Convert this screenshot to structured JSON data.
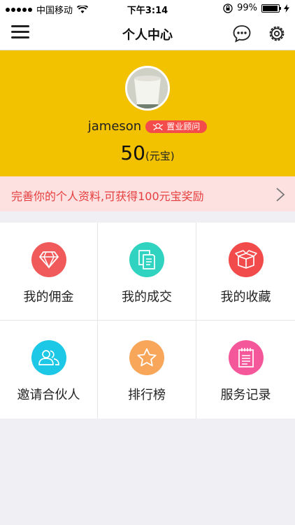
{
  "status_bar": {
    "carrier": "中国移动",
    "time": "下午3:14",
    "battery": "99%",
    "battery_level": 0.99
  },
  "nav": {
    "title": "个人中心",
    "icons": [
      "menu-icon",
      "chat-icon",
      "gear-icon"
    ]
  },
  "profile": {
    "username": "jameson",
    "role_badge": "置业顾问",
    "balance": "50",
    "balance_unit": "(元宝)",
    "background_color": "#f2c200"
  },
  "promo": {
    "text": "完善你的个人资料,可获得100元宝奖励"
  },
  "grid": {
    "items": [
      {
        "label": "我的佣金",
        "icon": "diamond-icon",
        "color": "#f15a5a"
      },
      {
        "label": "我的成交",
        "icon": "documents-icon",
        "color": "#2fd3c0"
      },
      {
        "label": "我的收藏",
        "icon": "box-icon",
        "color": "#f24b4b"
      },
      {
        "label": "邀请合伙人",
        "icon": "people-icon",
        "color": "#1cc8e6"
      },
      {
        "label": "排行榜",
        "icon": "star-icon",
        "color": "#f7a65a"
      },
      {
        "label": "服务记录",
        "icon": "notepad-icon",
        "color": "#f4589a"
      }
    ]
  }
}
